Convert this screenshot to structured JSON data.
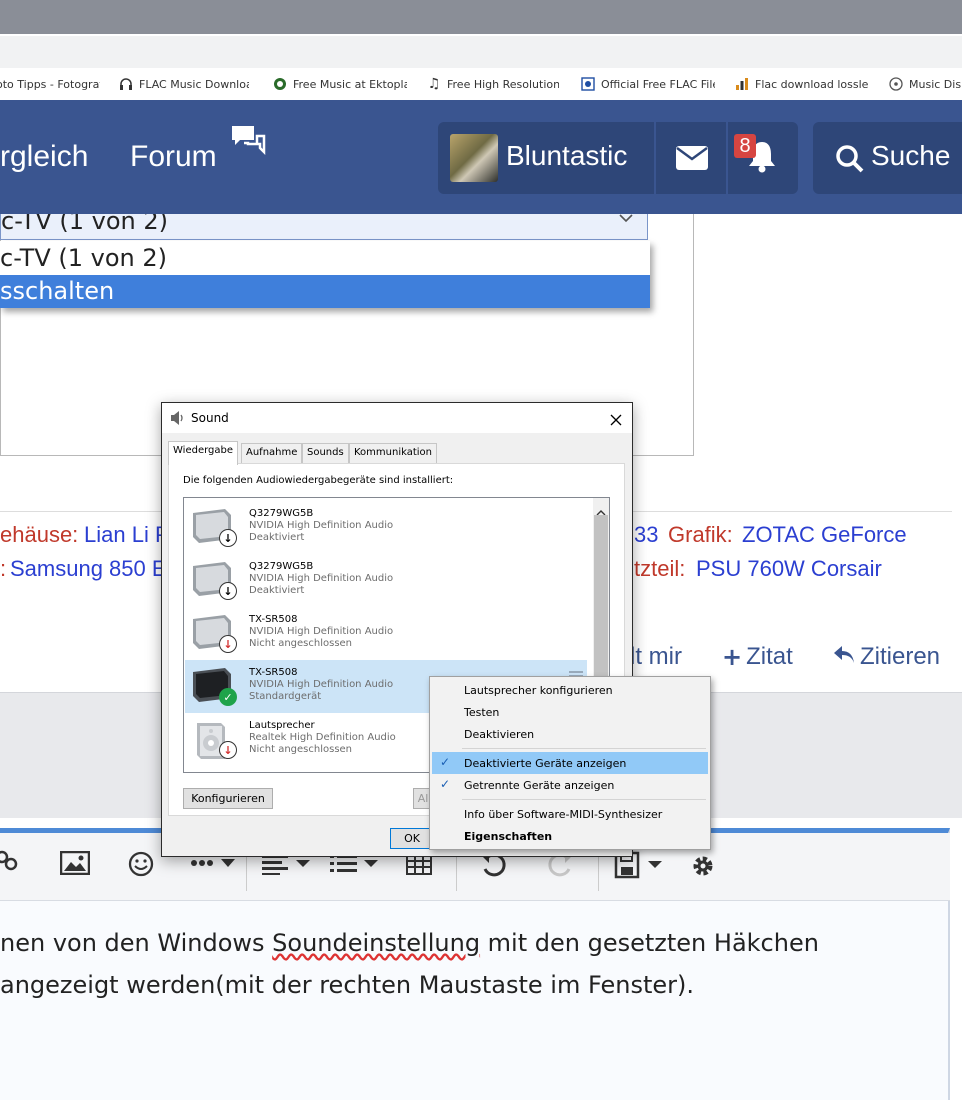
{
  "bookmarks": [
    {
      "label": "oto Tipps - Fotograf",
      "icon": "camera-icon"
    },
    {
      "label": "FLAC Music Downloa",
      "icon": "headphones-icon"
    },
    {
      "label": "Free Music at Ektopla",
      "icon": "ektoplazm-icon"
    },
    {
      "label": "Free High Resolution",
      "icon": "music-note-icon"
    },
    {
      "label": "Official Free FLAC File",
      "icon": "site-icon"
    },
    {
      "label": "Flac download lossle",
      "icon": "equalizer-icon"
    },
    {
      "label": "Music Dis",
      "icon": "disc-icon"
    }
  ],
  "navbar": {
    "item1": "rgleich",
    "item2": "Forum",
    "username": "Bluntastic",
    "notification_count": "8",
    "search": "Suche"
  },
  "dropdown": {
    "selected": "c-TV (1 von 2)",
    "option1": "c-TV (1 von 2)",
    "option2": "sschalten"
  },
  "signature": {
    "l1_label1": "ehäuse:",
    "l1_value1": "Lian Li P",
    "l1_value2": "33",
    "l1_label2": "Grafik:",
    "l1_value3": "ZOTAC GeForce",
    "l2_label1": ":",
    "l2_value1": "Samsung 850 E",
    "l2_label2": "tzteil:",
    "l2_value2": "PSU 760W Corsair"
  },
  "post_actions": {
    "like": "lt mir",
    "quote": "Zitat",
    "reply": "Zitieren"
  },
  "editor": {
    "line1_a": "nen von den Windows ",
    "line1_b": "Soundeinstellung",
    "line1_c": " mit den gesetzten Häkchen",
    "line2": " angezeigt werden(mit der rechten Maustaste im Fenster)."
  },
  "sound_dialog": {
    "title": "Sound",
    "tabs": [
      "Wiedergabe",
      "Aufnahme",
      "Sounds",
      "Kommunikation"
    ],
    "intro": "Die folgenden Audiowiedergabegeräte sind installiert:",
    "devices": [
      {
        "name": "Q3279WG5B",
        "driver": "NVIDIA High Definition Audio",
        "status": "Deaktiviert"
      },
      {
        "name": "Q3279WG5B",
        "driver": "NVIDIA High Definition Audio",
        "status": "Deaktiviert"
      },
      {
        "name": "TX-SR508",
        "driver": "NVIDIA High Definition Audio",
        "status": "Nicht angeschlossen"
      },
      {
        "name": "TX-SR508",
        "driver": "NVIDIA High Definition Audio",
        "status": "Standardgerät"
      },
      {
        "name": "Lautsprecher",
        "driver": "Realtek High Definition Audio",
        "status": "Nicht angeschlossen"
      }
    ],
    "configure_button": "Konfigurieren",
    "default_button_partial": "Al",
    "ok_button": "OK"
  },
  "context_menu": {
    "items": [
      {
        "label": "Lautsprecher konfigurieren",
        "checked": false
      },
      {
        "label": "Testen",
        "checked": false
      },
      {
        "label": "Deaktivieren",
        "checked": false
      },
      {
        "label": "Deaktivierte Geräte anzeigen",
        "checked": true
      },
      {
        "label": "Getrennte Geräte anzeigen",
        "checked": true
      },
      {
        "label": "Info über Software-MIDI-Synthesizer",
        "checked": false
      },
      {
        "label": "Eigenschaften",
        "checked": false
      }
    ]
  },
  "colors": {
    "navbar": "#3a5590",
    "navbar_box": "#2e4678",
    "badge": "#d64541",
    "signature_label": "#c0392b",
    "signature_value": "#2b3fd1",
    "menu_highlight": "#91c9f7"
  }
}
